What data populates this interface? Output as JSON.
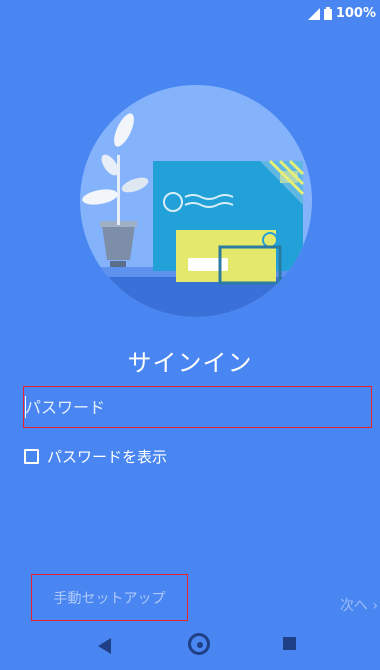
{
  "status_bar": {
    "battery_text": "100%",
    "icons": [
      "signal-icon",
      "battery-icon"
    ]
  },
  "header": {
    "title": "サインイン"
  },
  "password": {
    "placeholder": "パスワード",
    "value": ""
  },
  "show_password": {
    "label": "パスワードを表示",
    "checked": false
  },
  "footer": {
    "manual_setup": "手動セットアップ",
    "next": "次へ ›"
  },
  "nav": {
    "icons": [
      "back-icon",
      "home-icon",
      "recent-apps-icon"
    ]
  },
  "colors": {
    "background": "#4a86f2",
    "highlight_border": "#e8232b",
    "nav_icons": "#1f3f86"
  }
}
